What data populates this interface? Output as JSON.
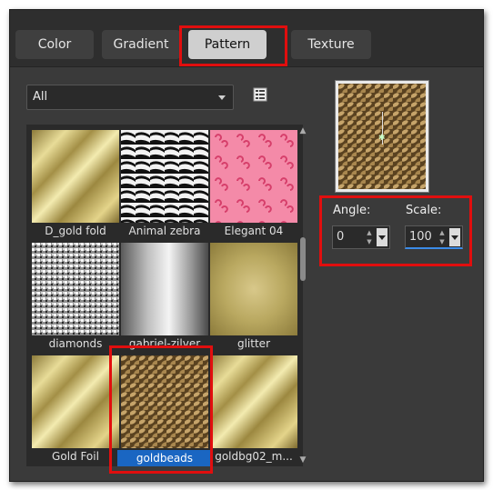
{
  "tabs": [
    {
      "label": "Color",
      "active": false
    },
    {
      "label": "Gradient",
      "active": false
    },
    {
      "label": "Pattern",
      "active": true
    },
    {
      "label": "Texture",
      "active": false
    }
  ],
  "category_select": {
    "value": "All"
  },
  "patterns": [
    {
      "name": "D_gold fold",
      "selected": false
    },
    {
      "name": "Animal zebra",
      "selected": false
    },
    {
      "name": "Elegant 04",
      "selected": false
    },
    {
      "name": "diamonds",
      "selected": false
    },
    {
      "name": "gabriel-zilver",
      "selected": false
    },
    {
      "name": "glitter",
      "selected": false
    },
    {
      "name": "Gold Foil",
      "selected": false
    },
    {
      "name": "goldbeads",
      "selected": true
    },
    {
      "name": "goldbg02_m...",
      "selected": false
    }
  ],
  "angle": {
    "label": "Angle:",
    "value": "0"
  },
  "scale": {
    "label": "Scale:",
    "value": "100"
  },
  "colors": {
    "selection_blue": "#1a66c2",
    "highlight_red": "#e10e0e"
  },
  "icons": [
    "list-view-icon",
    "dropdown-arrow-icon",
    "spin-up-icon",
    "spin-down-icon",
    "scroll-up-icon",
    "scroll-down-icon"
  ]
}
